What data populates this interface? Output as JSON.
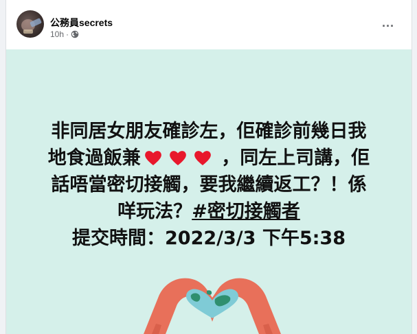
{
  "post": {
    "author": "公務員secrets",
    "time": "10h",
    "more_label": "···",
    "icons": {
      "avatar": "avatar",
      "privacy": "globe-icon",
      "more": "more-horizontal-icon"
    }
  },
  "content": {
    "line1": "非同居女朋友確診左，佢確診前幾日我",
    "line2_a": "地食過飯兼",
    "line2_b": " ，同左上司講，佢",
    "line3": "話唔當密切接觸，要我繼續返工？！係",
    "line4_a": "咩玩法？",
    "hashtag": "#密切接觸者",
    "line5_label": "提交時間：",
    "line5_time": "2022/3/3  下午5:38",
    "emoji": "heart-emoji",
    "colors": {
      "background": "#d5f0ea",
      "heart": "#e8182c",
      "hands": "#e8705a"
    }
  }
}
